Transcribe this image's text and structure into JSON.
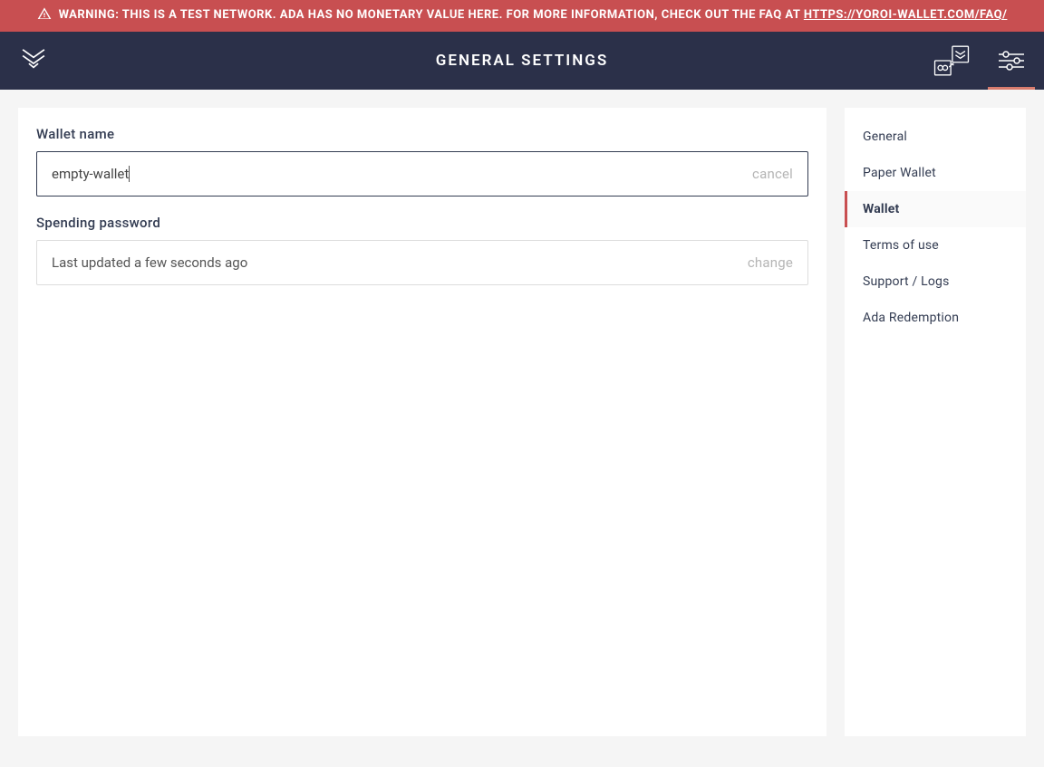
{
  "warning": {
    "prefix": "WARNING: THIS IS A TEST NETWORK. ADA HAS NO MONETARY VALUE HERE. FOR MORE INFORMATION, CHECK OUT THE FAQ AT ",
    "link_text": "HTTPS://YOROI-WALLET.COM/FAQ/"
  },
  "topbar": {
    "title": "GENERAL SETTINGS"
  },
  "main": {
    "wallet_name": {
      "label": "Wallet name",
      "value": "empty-wallet",
      "action": "cancel"
    },
    "spending_password": {
      "label": "Spending password",
      "status": "Last updated a few seconds ago",
      "action": "change"
    }
  },
  "sidebar": {
    "items": [
      {
        "label": "General",
        "active": false
      },
      {
        "label": "Paper Wallet",
        "active": false
      },
      {
        "label": "Wallet",
        "active": true
      },
      {
        "label": "Terms of use",
        "active": false
      },
      {
        "label": "Support / Logs",
        "active": false
      },
      {
        "label": "Ada Redemption",
        "active": false
      }
    ]
  }
}
